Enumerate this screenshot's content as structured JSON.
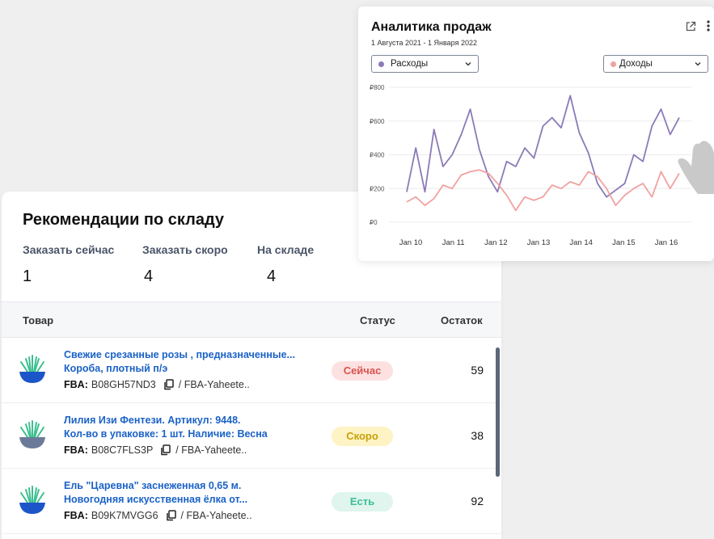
{
  "analytics": {
    "title": "Аналитика продаж",
    "date_range": "1 Августа 2021 - 1 Января 2022",
    "select_left": {
      "label": "Расходы",
      "dot_color": "#8b7ab8"
    },
    "select_right": {
      "label": "Доходы",
      "dot_color": "#f0a2a0"
    },
    "icons": [
      "external-link-icon",
      "more-vertical-icon",
      "chevron-down-icon"
    ]
  },
  "chart_data": {
    "type": "line",
    "x_tick_labels": [
      "Jan 10",
      "Jan 11",
      "Jan 12",
      "Jan 13",
      "Jan 14",
      "Jan 15",
      "Jan 16"
    ],
    "y_tick_labels": [
      "₽0",
      "₽200",
      "₽400",
      "₽600",
      "₽800"
    ],
    "ylim": [
      0,
      800
    ],
    "grid": true,
    "series": [
      {
        "name": "Расходы",
        "color": "#8b7ab8",
        "values": [
          180,
          440,
          180,
          550,
          330,
          400,
          520,
          670,
          430,
          270,
          180,
          360,
          330,
          440,
          380,
          570,
          620,
          560,
          750,
          530,
          410,
          230,
          150,
          190,
          230,
          400,
          360,
          570,
          670,
          520,
          620
        ]
      },
      {
        "name": "Доходы",
        "color": "#f0a2a0",
        "values": [
          120,
          150,
          100,
          140,
          220,
          200,
          280,
          300,
          310,
          290,
          230,
          160,
          70,
          150,
          130,
          150,
          220,
          200,
          240,
          220,
          300,
          270,
          200,
          100,
          160,
          200,
          230,
          150,
          300,
          200,
          290
        ]
      }
    ]
  },
  "inventory": {
    "title": "Рекомендации по складу",
    "stats": [
      {
        "label": "Заказать сейчас",
        "value": "1"
      },
      {
        "label": "Заказать скоро",
        "value": "4"
      },
      {
        "label": "На складе",
        "value": "4"
      }
    ],
    "columns": {
      "product": "Товар",
      "status": "Статус",
      "stock": "Остаток"
    },
    "rows": [
      {
        "name_line1": "Свежие срезанные розы , предназначенные...",
        "name_line2": "Короба, плотный п/э",
        "fba_label": "FBA:",
        "fba_code": "B08GH57ND3",
        "fba_store": "/ FBA-Yaheete..",
        "status": "Сейчас",
        "status_bg": "#fde1e1",
        "status_fg": "#d9534f",
        "stock": "59",
        "pot_color": "#1c55c8"
      },
      {
        "name_line1": "Лилия Изи Фентези. Артикул: 9448.",
        "name_line2": "Кол-во в упаковке: 1 шт. Наличие: Весна",
        "fba_label": "FBA:",
        "fba_code": "B08C7FLS3P",
        "fba_store": "/ FBA-Yaheete..",
        "status": "Скоро",
        "status_bg": "#fdf3c4",
        "status_fg": "#c9a10a",
        "stock": "38",
        "pot_color": "#6c7a99"
      },
      {
        "name_line1": "Ель \"Царевна\" заснеженная 0,65 м.",
        "name_line2": "Новогодняя искусственная ёлка от...",
        "fba_label": "FBA:",
        "fba_code": "B09K7MVGG6",
        "fba_store": "/ FBA-Yaheete..",
        "status": "Есть",
        "status_bg": "#dff5ee",
        "status_fg": "#3cbf98",
        "stock": "92",
        "pot_color": "#1c55c8"
      }
    ]
  }
}
